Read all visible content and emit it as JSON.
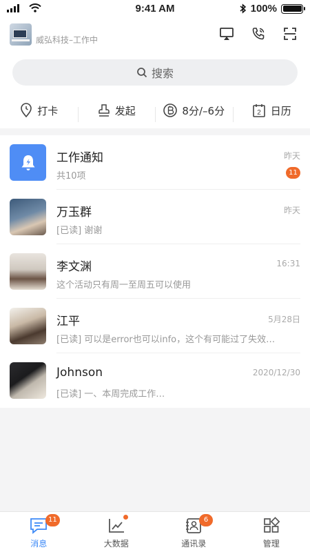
{
  "status_bar": {
    "time": "9:41 AM",
    "battery": "100%"
  },
  "header": {
    "company": "威弘科技–工作中"
  },
  "search": {
    "placeholder": "搜索"
  },
  "quick_actions": [
    {
      "label": "打卡",
      "icon": "location-pin-icon"
    },
    {
      "label": "发起",
      "icon": "stamp-icon"
    },
    {
      "label": "8分/–6分",
      "icon": "points-coin-icon"
    },
    {
      "label": "日历",
      "icon": "calendar-icon",
      "day": "2"
    }
  ],
  "conversations": [
    {
      "name": "工作通知",
      "preview": "共10项",
      "time": "昨天",
      "badge": "11",
      "avatar": "notification-bell-icon"
    },
    {
      "name": "万玉群",
      "preview": "[已读] 谢谢",
      "time": "昨天"
    },
    {
      "name": "李文渊",
      "preview": "这个活动只有周一至周五可以使用",
      "time": "16:31"
    },
    {
      "name": "江平",
      "preview": "[已读] 可以是error也可以info，这个有可能过了失效…",
      "time": "5月28日"
    },
    {
      "name": "Johnson",
      "preview": "[已读] 一、本周完成工作…",
      "time": "2020/12/30"
    }
  ],
  "tabs": [
    {
      "label": "消息",
      "badge": "11",
      "icon": "message-icon",
      "active": true
    },
    {
      "label": "大数据",
      "icon": "chart-trend-icon",
      "dot": true
    },
    {
      "label": "通讯录",
      "badge": "6",
      "icon": "contacts-icon"
    },
    {
      "label": "管理",
      "icon": "grid-apps-icon"
    }
  ],
  "colors": {
    "accent": "#3d8af7",
    "badge": "#f06a2a",
    "notice_avatar": "#4f8df5"
  }
}
